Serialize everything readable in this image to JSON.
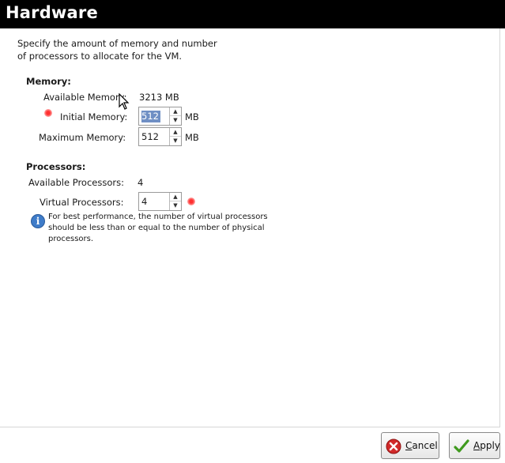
{
  "header": {
    "title": "Hardware"
  },
  "description": {
    "line1": "Specify the amount of memory and number",
    "line2": "of processors to allocate for the VM."
  },
  "memory": {
    "section_label": "Memory:",
    "available_label": "Available Memory:",
    "available_value": "3213 MB",
    "initial_label": "Initial Memory:",
    "initial_value": "512",
    "initial_unit": "MB",
    "maximum_label": "Maximum Memory:",
    "maximum_value": "512",
    "maximum_unit": "MB"
  },
  "processors": {
    "section_label": "Processors:",
    "available_label": "Available Processors:",
    "available_value": "4",
    "virtual_label": "Virtual Processors:",
    "virtual_value": "4",
    "info_line1": "For best performance, the number of virtual processors",
    "info_line2": "should be less than or equal to the number of physical",
    "info_line3": "processors."
  },
  "footer": {
    "cancel_label": "Cancel",
    "apply_label": "Apply"
  },
  "icons": {
    "info": "info-icon",
    "cancel": "cancel-icon",
    "apply": "checkmark-icon",
    "required_marker": "red-dot-icon"
  },
  "colors": {
    "header_bg": "#000000",
    "selection": "#6f8fc4",
    "required_marker": "#ff3030"
  }
}
